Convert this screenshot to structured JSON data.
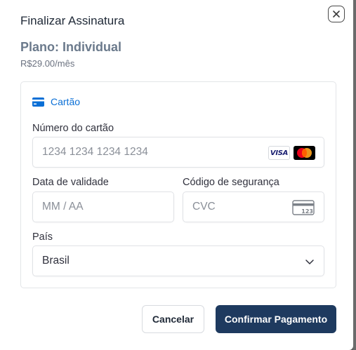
{
  "modal": {
    "title": "Finalizar Assinatura",
    "close_icon": "close-icon"
  },
  "plan": {
    "name": "Plano: Individual",
    "price": "R$29.00/mês"
  },
  "payment": {
    "tab_label": "Cartão",
    "tab_icon": "credit-card-icon",
    "card_number": {
      "label": "Número do cartão",
      "placeholder": "1234 1234 1234 1234",
      "brands": [
        "VISA",
        "mastercard"
      ]
    },
    "expiry": {
      "label": "Data de validade",
      "placeholder": "MM / AA"
    },
    "cvc": {
      "label": "Código de segurança",
      "placeholder": "CVC",
      "icon_text": "123"
    },
    "country": {
      "label": "País",
      "value": "Brasil"
    }
  },
  "actions": {
    "cancel_label": "Cancelar",
    "confirm_label": "Confirmar Pagamento"
  },
  "colors": {
    "accent": "#0a6fd6",
    "primary_button": "#1e3a5f",
    "plan_name": "#6b7a8c"
  }
}
